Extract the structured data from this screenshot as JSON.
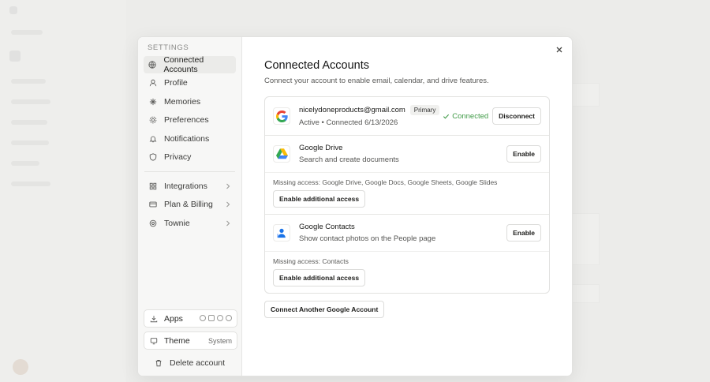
{
  "settings": {
    "heading": "SETTINGS",
    "nav": [
      {
        "label": "Connected Accounts",
        "icon": "globe-icon",
        "active": true
      },
      {
        "label": "Profile",
        "icon": "user-icon"
      },
      {
        "label": "Memories",
        "icon": "sparkle-icon"
      },
      {
        "label": "Preferences",
        "icon": "gear-icon"
      },
      {
        "label": "Notifications",
        "icon": "bell-icon"
      },
      {
        "label": "Privacy",
        "icon": "shield-icon"
      }
    ],
    "nav2": [
      {
        "label": "Integrations",
        "icon": "grid-icon"
      },
      {
        "label": "Plan & Billing",
        "icon": "credit-card-icon"
      },
      {
        "label": "Townie",
        "icon": "townie-icon"
      }
    ],
    "apps_label": "Apps",
    "theme_label": "Theme",
    "theme_value": "System",
    "delete_label": "Delete account"
  },
  "main": {
    "title": "Connected Accounts",
    "subtitle": "Connect your account to enable email, calendar, and drive features.",
    "account": {
      "email": "nicelydoneproducts@gmail.com",
      "badge": "Primary",
      "status_line": "Active • Connected 6/13/2026",
      "connected_label": "Connected",
      "disconnect_label": "Disconnect"
    },
    "services": [
      {
        "name": "Google Drive",
        "description": "Search and create documents",
        "enable_label": "Enable",
        "missing": "Missing access: Google Drive, Google Docs, Google Sheets, Google Slides",
        "additional_label": "Enable additional access"
      },
      {
        "name": "Google Contacts",
        "description": "Show contact photos on the People page",
        "enable_label": "Enable",
        "missing": "Missing access: Contacts",
        "additional_label": "Enable additional access"
      }
    ],
    "connect_another_label": "Connect Another Google Account"
  },
  "colors": {
    "connected": "#3f9a46",
    "google_blue": "#4285F4",
    "google_red": "#EA4335",
    "google_yellow": "#FBBC05",
    "google_green": "#34A853",
    "contacts_blue": "#1a73e8"
  }
}
